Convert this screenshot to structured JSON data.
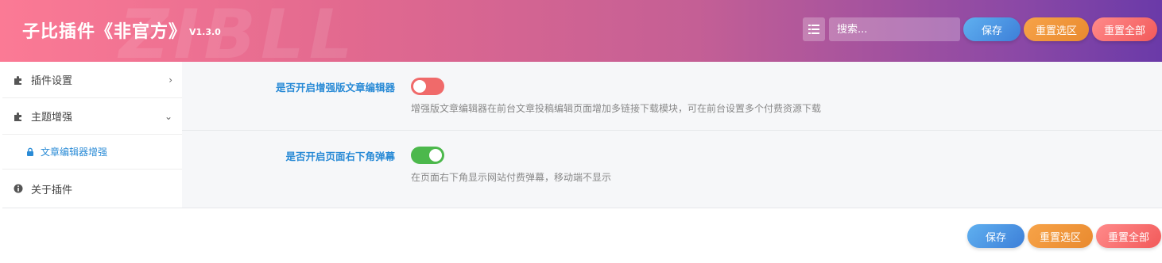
{
  "header": {
    "title": "子比插件《非官方》",
    "version": "V1.3.0",
    "watermark": "ZIBLL",
    "search_placeholder": "搜索...",
    "save_label": "保存",
    "reset_section_label": "重置选区",
    "reset_all_label": "重置全部"
  },
  "sidebar": {
    "items": [
      {
        "label": "插件设置",
        "icon": "puzzle-icon",
        "chevron": "›"
      },
      {
        "label": "主题增强",
        "icon": "puzzle-icon",
        "chevron": "⌄"
      },
      {
        "label": "文章编辑器增强",
        "icon": "lock-icon"
      },
      {
        "label": "关于插件",
        "icon": "info-icon"
      }
    ]
  },
  "settings": [
    {
      "label": "是否开启增强版文章编辑器",
      "enabled": false,
      "description": "增强版文章编辑器在前台文章投稿编辑页面增加多链接下载模块，可在前台设置多个付费资源下载"
    },
    {
      "label": "是否开启页面右下角弹幕",
      "enabled": true,
      "description": "在页面右下角显示网站付费弹幕，移动端不显示"
    }
  ],
  "footer": {
    "save_label": "保存",
    "reset_section_label": "重置选区",
    "reset_all_label": "重置全部"
  },
  "colors": {
    "accent_blue": "#2a8bd6",
    "toggle_off": "#f06a6a",
    "toggle_on": "#4cb84c",
    "btn_blue": "#4a90e2",
    "btn_orange": "#f0952f",
    "btn_red": "#f36a6a"
  }
}
